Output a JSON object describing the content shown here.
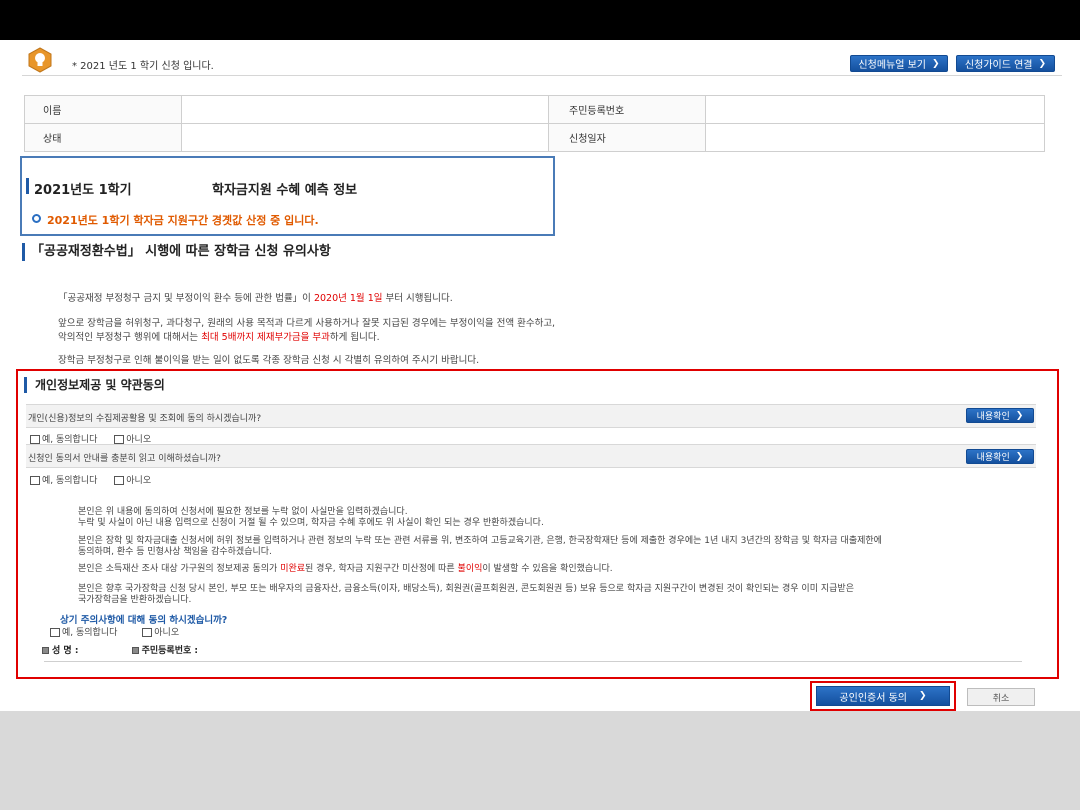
{
  "notice": {
    "text": "* 2021 년도 1 학기 신청 입니다.",
    "manual_button": "신청메뉴얼 보기",
    "guide_button": "신청가이드 연결"
  },
  "info_table": {
    "name_label": "이름",
    "name_value": "",
    "rrn_label": "주민등록번호",
    "rrn_value": "",
    "status_label": "상태",
    "status_value": "",
    "date_label": "신청일자",
    "date_value": ""
  },
  "prediction": {
    "term": "2021년도 1학기",
    "title": "학자금지원 수혜 예측 정보",
    "message": "2021년도 1학기 학자금 지원구간 경곗값 산정 중 입니다."
  },
  "notice_section": {
    "title": "「공공재정환수법」 시행에 따른 장학금 신청 유의사항",
    "p1_a": "「공공재정 부정청구 금지 및 부정이익 환수 등에 관한 법률」이 ",
    "p1_red": "2020년 1월 1일",
    "p1_b": " 부터 시행됩니다.",
    "p2_line1": "앞으로 장학금을 허위청구, 과다청구, 원래의 사용 목적과 다르게 사용하거나 잘못 지급된 경우에는 부정이익을 전액 환수하고,",
    "p2_line2_a": "악의적인 부정청구 행위에 대해서는 ",
    "p2_line2_red": "최대 5배까지 제재부가금을 부과",
    "p2_line2_b": "하게 됩니다.",
    "p3": "장학금 부정청구로 인해 불이익을 받는 일이 없도록 각종 장학금 신청 시 각별히 유의하여 주시기 바랍니다."
  },
  "agreement": {
    "title": "개인정보제공 및 약관동의",
    "q1": "개인(신용)정보의 수집제공활용 및 조회에 동의 하시겠습니까?",
    "q2": "신청인 동의서 안내를 충분히 읽고 이해하셨습니까?",
    "detail_button": "내용확인",
    "yes": "예, 동의합니다",
    "no": "아니오",
    "b1_l1": "본인은 위 내용에 동의하여 신청서에 필요한 정보를 누락 없이 사실만을 입력하겠습니다.",
    "b1_l2": "누락 및 사실이 아닌 내용 입력으로 신청이 거절 될 수 있으며, 학자금 수혜 후에도 위 사실이 확인 되는 경우 반환하겠습니다.",
    "b2_l1": "본인은 장학 및 학자금대출 신청서에 허위 정보를 입력하거나 관련 정보의 누락 또는 관련 서류를 위, 변조하여 고등교육기관, 은행, 한국장학재단 등에 제출한 경우에는 1년 내지 3년간의 장학금 및 학자금 대출제한에",
    "b2_l2": "동의하며, 환수 등 민형사상 책임을 감수하겠습니다.",
    "b3_a": "본인은 소득재산 조사 대상 가구원의 정보제공 동의가 ",
    "b3_red1": "미완료",
    "b3_b": "된 경우, 학자금 지원구간 미산정에 따른 ",
    "b3_red2": "불이익",
    "b3_c": "이 발생할 수 있음을 확인했습니다.",
    "b4_l1": "본인은 향후 국가장학금 신청 당시 본인, 부모 또는 배우자의 금융자산, 금융소득(이자, 배당소득), 회원권(골프회원권, 콘도회원권 등) 보유 등으로 학자금 지원구간이 변경된 것이 확인되는 경우 이미 지급받은",
    "b4_l2": "국가장학금을 반환하겠습니다.",
    "confirm_q": "상기 주의사항에 대해 동의 하시겠습니까?",
    "yes2": "예, 동의합니다",
    "name_label": "성 명 :",
    "rrn_label": "주민등록번호 :"
  },
  "buttons": {
    "cert": "공인인증서 동의",
    "cancel": "취소"
  },
  "colors": {
    "accent_blue": "#1f5aa6",
    "highlight_red": "#e00000",
    "warning_orange": "#e05a00"
  }
}
